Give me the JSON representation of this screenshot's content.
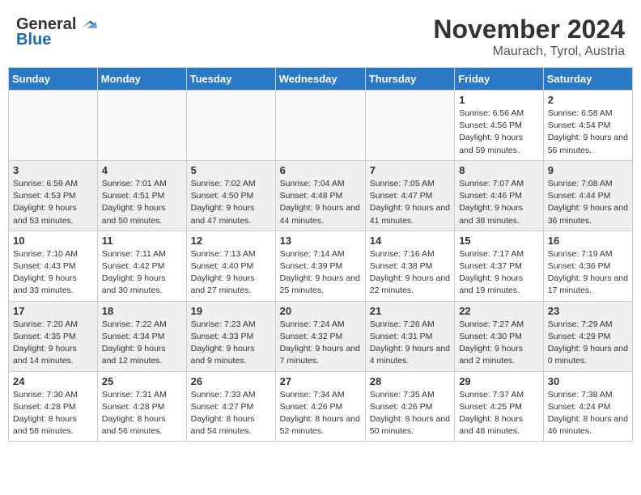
{
  "header": {
    "logo": {
      "general": "General",
      "blue": "Blue",
      "tagline": ""
    },
    "month": "November 2024",
    "location": "Maurach, Tyrol, Austria"
  },
  "weekdays": [
    "Sunday",
    "Monday",
    "Tuesday",
    "Wednesday",
    "Thursday",
    "Friday",
    "Saturday"
  ],
  "weeks": [
    [
      {
        "day": "",
        "sunrise": "",
        "sunset": "",
        "daylight": "",
        "empty": true
      },
      {
        "day": "",
        "sunrise": "",
        "sunset": "",
        "daylight": "",
        "empty": true
      },
      {
        "day": "",
        "sunrise": "",
        "sunset": "",
        "daylight": "",
        "empty": true
      },
      {
        "day": "",
        "sunrise": "",
        "sunset": "",
        "daylight": "",
        "empty": true
      },
      {
        "day": "",
        "sunrise": "",
        "sunset": "",
        "daylight": "",
        "empty": true
      },
      {
        "day": "1",
        "sunrise": "Sunrise: 6:56 AM",
        "sunset": "Sunset: 4:56 PM",
        "daylight": "Daylight: 9 hours and 59 minutes.",
        "empty": false
      },
      {
        "day": "2",
        "sunrise": "Sunrise: 6:58 AM",
        "sunset": "Sunset: 4:54 PM",
        "daylight": "Daylight: 9 hours and 56 minutes.",
        "empty": false
      }
    ],
    [
      {
        "day": "3",
        "sunrise": "Sunrise: 6:59 AM",
        "sunset": "Sunset: 4:53 PM",
        "daylight": "Daylight: 9 hours and 53 minutes.",
        "empty": false
      },
      {
        "day": "4",
        "sunrise": "Sunrise: 7:01 AM",
        "sunset": "Sunset: 4:51 PM",
        "daylight": "Daylight: 9 hours and 50 minutes.",
        "empty": false
      },
      {
        "day": "5",
        "sunrise": "Sunrise: 7:02 AM",
        "sunset": "Sunset: 4:50 PM",
        "daylight": "Daylight: 9 hours and 47 minutes.",
        "empty": false
      },
      {
        "day": "6",
        "sunrise": "Sunrise: 7:04 AM",
        "sunset": "Sunset: 4:48 PM",
        "daylight": "Daylight: 9 hours and 44 minutes.",
        "empty": false
      },
      {
        "day": "7",
        "sunrise": "Sunrise: 7:05 AM",
        "sunset": "Sunset: 4:47 PM",
        "daylight": "Daylight: 9 hours and 41 minutes.",
        "empty": false
      },
      {
        "day": "8",
        "sunrise": "Sunrise: 7:07 AM",
        "sunset": "Sunset: 4:46 PM",
        "daylight": "Daylight: 9 hours and 38 minutes.",
        "empty": false
      },
      {
        "day": "9",
        "sunrise": "Sunrise: 7:08 AM",
        "sunset": "Sunset: 4:44 PM",
        "daylight": "Daylight: 9 hours and 36 minutes.",
        "empty": false
      }
    ],
    [
      {
        "day": "10",
        "sunrise": "Sunrise: 7:10 AM",
        "sunset": "Sunset: 4:43 PM",
        "daylight": "Daylight: 9 hours and 33 minutes.",
        "empty": false
      },
      {
        "day": "11",
        "sunrise": "Sunrise: 7:11 AM",
        "sunset": "Sunset: 4:42 PM",
        "daylight": "Daylight: 9 hours and 30 minutes.",
        "empty": false
      },
      {
        "day": "12",
        "sunrise": "Sunrise: 7:13 AM",
        "sunset": "Sunset: 4:40 PM",
        "daylight": "Daylight: 9 hours and 27 minutes.",
        "empty": false
      },
      {
        "day": "13",
        "sunrise": "Sunrise: 7:14 AM",
        "sunset": "Sunset: 4:39 PM",
        "daylight": "Daylight: 9 hours and 25 minutes.",
        "empty": false
      },
      {
        "day": "14",
        "sunrise": "Sunrise: 7:16 AM",
        "sunset": "Sunset: 4:38 PM",
        "daylight": "Daylight: 9 hours and 22 minutes.",
        "empty": false
      },
      {
        "day": "15",
        "sunrise": "Sunrise: 7:17 AM",
        "sunset": "Sunset: 4:37 PM",
        "daylight": "Daylight: 9 hours and 19 minutes.",
        "empty": false
      },
      {
        "day": "16",
        "sunrise": "Sunrise: 7:19 AM",
        "sunset": "Sunset: 4:36 PM",
        "daylight": "Daylight: 9 hours and 17 minutes.",
        "empty": false
      }
    ],
    [
      {
        "day": "17",
        "sunrise": "Sunrise: 7:20 AM",
        "sunset": "Sunset: 4:35 PM",
        "daylight": "Daylight: 9 hours and 14 minutes.",
        "empty": false
      },
      {
        "day": "18",
        "sunrise": "Sunrise: 7:22 AM",
        "sunset": "Sunset: 4:34 PM",
        "daylight": "Daylight: 9 hours and 12 minutes.",
        "empty": false
      },
      {
        "day": "19",
        "sunrise": "Sunrise: 7:23 AM",
        "sunset": "Sunset: 4:33 PM",
        "daylight": "Daylight: 9 hours and 9 minutes.",
        "empty": false
      },
      {
        "day": "20",
        "sunrise": "Sunrise: 7:24 AM",
        "sunset": "Sunset: 4:32 PM",
        "daylight": "Daylight: 9 hours and 7 minutes.",
        "empty": false
      },
      {
        "day": "21",
        "sunrise": "Sunrise: 7:26 AM",
        "sunset": "Sunset: 4:31 PM",
        "daylight": "Daylight: 9 hours and 4 minutes.",
        "empty": false
      },
      {
        "day": "22",
        "sunrise": "Sunrise: 7:27 AM",
        "sunset": "Sunset: 4:30 PM",
        "daylight": "Daylight: 9 hours and 2 minutes.",
        "empty": false
      },
      {
        "day": "23",
        "sunrise": "Sunrise: 7:29 AM",
        "sunset": "Sunset: 4:29 PM",
        "daylight": "Daylight: 9 hours and 0 minutes.",
        "empty": false
      }
    ],
    [
      {
        "day": "24",
        "sunrise": "Sunrise: 7:30 AM",
        "sunset": "Sunset: 4:28 PM",
        "daylight": "Daylight: 8 hours and 58 minutes.",
        "empty": false
      },
      {
        "day": "25",
        "sunrise": "Sunrise: 7:31 AM",
        "sunset": "Sunset: 4:28 PM",
        "daylight": "Daylight: 8 hours and 56 minutes.",
        "empty": false
      },
      {
        "day": "26",
        "sunrise": "Sunrise: 7:33 AM",
        "sunset": "Sunset: 4:27 PM",
        "daylight": "Daylight: 8 hours and 54 minutes.",
        "empty": false
      },
      {
        "day": "27",
        "sunrise": "Sunrise: 7:34 AM",
        "sunset": "Sunset: 4:26 PM",
        "daylight": "Daylight: 8 hours and 52 minutes.",
        "empty": false
      },
      {
        "day": "28",
        "sunrise": "Sunrise: 7:35 AM",
        "sunset": "Sunset: 4:26 PM",
        "daylight": "Daylight: 8 hours and 50 minutes.",
        "empty": false
      },
      {
        "day": "29",
        "sunrise": "Sunrise: 7:37 AM",
        "sunset": "Sunset: 4:25 PM",
        "daylight": "Daylight: 8 hours and 48 minutes.",
        "empty": false
      },
      {
        "day": "30",
        "sunrise": "Sunrise: 7:38 AM",
        "sunset": "Sunset: 4:24 PM",
        "daylight": "Daylight: 8 hours and 46 minutes.",
        "empty": false
      }
    ]
  ]
}
